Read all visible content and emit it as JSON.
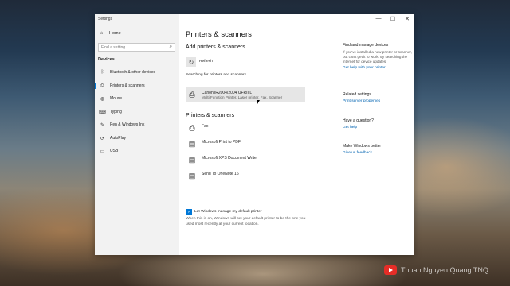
{
  "window": {
    "title": "Settings",
    "controls": {
      "minimize": "—",
      "maximize": "☐",
      "close": "✕"
    }
  },
  "sidebar": {
    "home_label": "Home",
    "search_placeholder": "Find a setting",
    "section_heading": "Devices",
    "items": [
      {
        "label": "Bluetooth & other devices",
        "icon": "bluetooth-icon"
      },
      {
        "label": "Printers & scanners",
        "icon": "printer-icon",
        "active": true
      },
      {
        "label": "Mouse",
        "icon": "mouse-icon"
      },
      {
        "label": "Typing",
        "icon": "keyboard-icon"
      },
      {
        "label": "Pen & Windows Ink",
        "icon": "pen-icon"
      },
      {
        "label": "AutoPlay",
        "icon": "autoplay-icon"
      },
      {
        "label": "USB",
        "icon": "usb-icon"
      }
    ]
  },
  "main": {
    "title": "Printers & scanners",
    "add_heading": "Add printers & scanners",
    "refresh_label": "Refresh",
    "searching_text": "Searching for printers and scanners",
    "found_printer": {
      "name": "Canon iR2004/2004 UFRII LT",
      "description": "Multi Function Printer, Laser printer, Fax, Scanner"
    },
    "list_heading": "Printers & scanners",
    "printers": [
      "Fax",
      "Microsoft Print to PDF",
      "Microsoft XPS Document Writer",
      "Send To OneNote 16"
    ],
    "default_checkbox_label": "Let Windows manage my default printer",
    "default_checkbox_checked": true,
    "default_description": "When this is on, Windows will set your default printer to be the one you used most recently at your current location."
  },
  "related": {
    "find_heading": "Find and manage devices",
    "find_text": "If you've installed a new printer or scanner, but can't get it to work, try searching the internet for device updates.",
    "find_link": "Get help with your printer",
    "settings_heading": "Related settings",
    "print_server_link": "Print server properties",
    "question_heading": "Have a question?",
    "get_help_link": "Get help",
    "better_heading": "Make Windows better",
    "feedback_link": "Give us feedback"
  },
  "watermark": {
    "channel": "Thuan Nguyen Quang TNQ"
  },
  "colors": {
    "accent": "#0078d7",
    "link": "#0063b1",
    "sidebar_bg": "#f2f2f2"
  }
}
